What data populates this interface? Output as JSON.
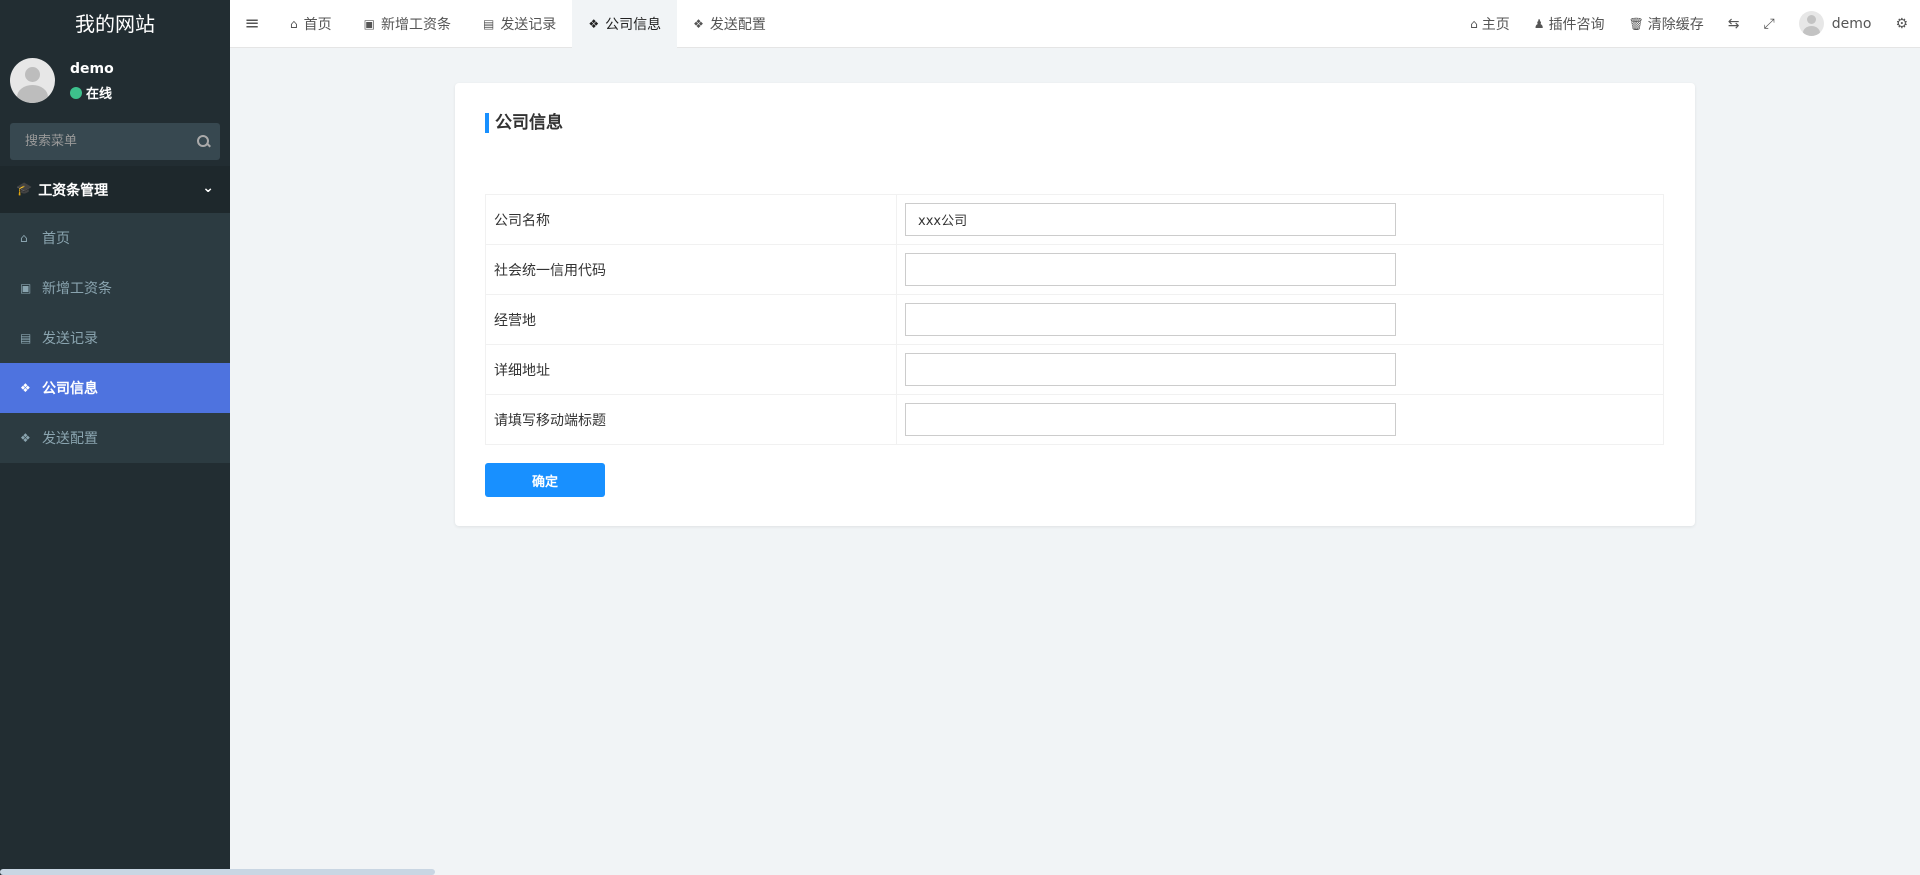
{
  "brand": "我的网站",
  "user": {
    "name": "demo",
    "status": "在线"
  },
  "search": {
    "placeholder": "搜索菜单"
  },
  "sidebar": {
    "group": "工资条管理",
    "items": [
      {
        "label": "首页",
        "icon": "home-icon"
      },
      {
        "label": "新增工资条",
        "icon": "picture-icon"
      },
      {
        "label": "发送记录",
        "icon": "file-icon"
      },
      {
        "label": "公司信息",
        "icon": "cubes-icon",
        "active": true
      },
      {
        "label": "发送配置",
        "icon": "cubes-icon"
      }
    ]
  },
  "tabs": [
    {
      "label": "首页",
      "icon": "home-icon"
    },
    {
      "label": "新增工资条",
      "icon": "picture-icon"
    },
    {
      "label": "发送记录",
      "icon": "file-icon"
    },
    {
      "label": "公司信息",
      "icon": "cubes-icon",
      "active": true
    },
    {
      "label": "发送配置",
      "icon": "cubes-icon"
    }
  ],
  "topright": {
    "home": "主页",
    "plugin": "插件咨询",
    "cache": "清除缓存",
    "username": "demo"
  },
  "card": {
    "title": "公司信息",
    "fields": [
      {
        "label": "公司名称",
        "value": "xxx公司"
      },
      {
        "label": "社会统一信用代码",
        "value": ""
      },
      {
        "label": "经营地",
        "value": ""
      },
      {
        "label": "详细地址",
        "value": ""
      },
      {
        "label": "请填写移动端标题",
        "value": ""
      }
    ],
    "submit": "确定"
  },
  "colors": {
    "accent": "#1890ff",
    "sidebar_active": "#4e73df",
    "sidebar_bg": "#222d32"
  }
}
